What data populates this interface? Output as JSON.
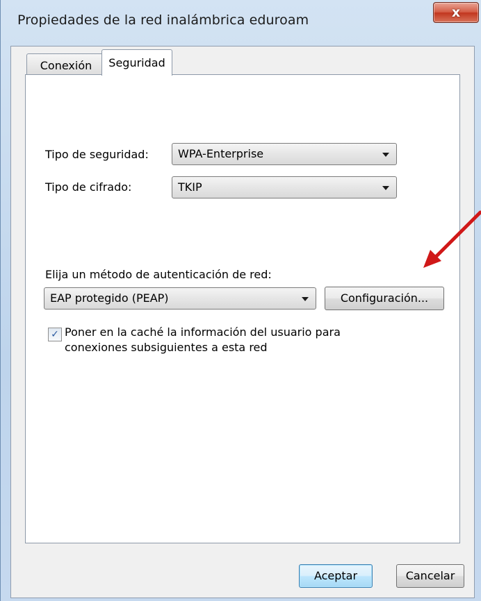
{
  "window": {
    "title": "Propiedades de la red inalámbrica eduroam",
    "close_symbol": "x"
  },
  "tabs": [
    {
      "label": "Conexión",
      "active": false
    },
    {
      "label": "Seguridad",
      "active": true
    }
  ],
  "security": {
    "type_label": "Tipo de seguridad:",
    "type_value": "WPA-Enterprise",
    "cipher_label": "Tipo de cifrado:",
    "cipher_value": "TKIP",
    "auth_label": "Elija un método de autenticación de red:",
    "auth_value": "EAP protegido (PEAP)",
    "settings_button": "Configuración...",
    "cache_checkbox_label_line1": "Poner en la caché la información del usuario para",
    "cache_checkbox_label_line2": "conexiones subsiguientes a esta red",
    "cache_checked": true
  },
  "footer": {
    "ok_label": "Aceptar",
    "cancel_label": "Cancelar"
  },
  "annotation": {
    "arrow_color": "#d01818",
    "arrow_icon": "red-arrow-icon"
  },
  "icons": {
    "checkmark": "✓"
  }
}
